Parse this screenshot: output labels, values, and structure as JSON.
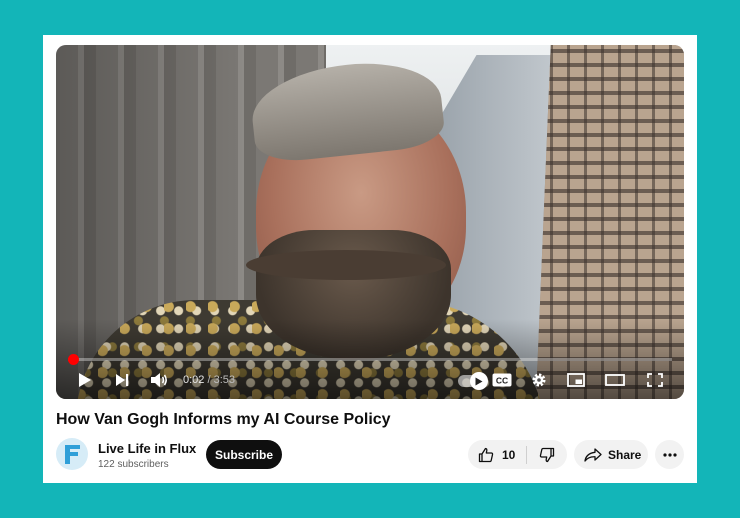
{
  "video": {
    "title": "How Van Gogh Informs my AI Course Policy",
    "current_time": "0:02",
    "time_separator": " / ",
    "duration": "3:53",
    "progress": 0.009,
    "accent_color": "#ff0000"
  },
  "controls": {
    "play_icon": "play-icon",
    "next_icon": "next-icon",
    "volume_icon": "volume-icon",
    "autoplay_icon": "autoplay-toggle-icon",
    "captions_label": "CC",
    "settings_icon": "gear-icon",
    "miniplayer_icon": "miniplayer-icon",
    "theater_icon": "theater-mode-icon",
    "fullscreen_icon": "fullscreen-icon"
  },
  "channel": {
    "name": "Live Life in Flux",
    "subscribers": "122 subscribers",
    "avatar_letter": "F",
    "subscribe_label": "Subscribe"
  },
  "actions": {
    "like_count": "10",
    "share_label": "Share",
    "more_icon": "more-horizontal-icon"
  },
  "colors": {
    "background": "#13b5b8",
    "subscribe_bg": "#0f0f0f",
    "pill_bg": "#f2f2f2",
    "avatar_color": "#2f9fd8"
  }
}
